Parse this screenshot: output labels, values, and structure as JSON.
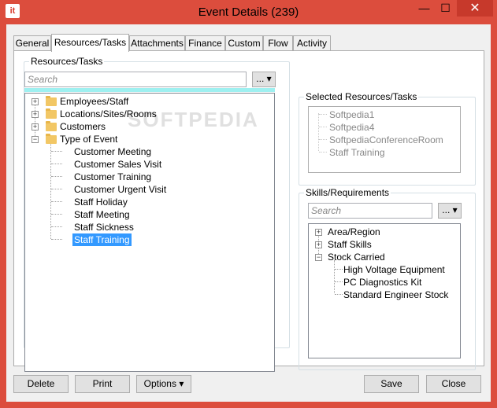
{
  "window": {
    "title": "Event Details (239)",
    "icon_text": "it",
    "controls": {
      "minimize": "—",
      "maximize": "☐",
      "close": "✕"
    }
  },
  "tabs": [
    {
      "label": "General"
    },
    {
      "label": "Resources/Tasks",
      "active": true
    },
    {
      "label": "Attachments"
    },
    {
      "label": "Finance"
    },
    {
      "label": "Custom"
    },
    {
      "label": "Flow"
    },
    {
      "label": "Activity"
    }
  ],
  "resources": {
    "group_label": "Resources/Tasks",
    "search_placeholder": "Search",
    "dropdown_label": "...",
    "watermark": "SOFTPEDIA",
    "tree": [
      {
        "label": "Employees/Staff"
      },
      {
        "label": "Locations/Sites/Rooms"
      },
      {
        "label": "Customers"
      },
      {
        "label": "Type of Event"
      },
      {
        "label": "Customer Meeting"
      },
      {
        "label": "Customer Sales Visit"
      },
      {
        "label": "Customer Training"
      },
      {
        "label": "Customer Urgent Visit"
      },
      {
        "label": "Staff Holiday"
      },
      {
        "label": "Staff Meeting"
      },
      {
        "label": "Staff Sickness"
      },
      {
        "label": "Staff Training"
      }
    ]
  },
  "selected": {
    "group_label": "Selected Resources/Tasks",
    "items": [
      {
        "label": "Softpedia1"
      },
      {
        "label": "Softpedia4"
      },
      {
        "label": "SoftpediaConferenceRoom"
      },
      {
        "label": "Staff Training"
      }
    ]
  },
  "skills": {
    "group_label": "Skills/Requirements",
    "search_placeholder": "Search",
    "dropdown_label": "...",
    "tree": [
      {
        "label": "Area/Region"
      },
      {
        "label": "Staff Skills"
      },
      {
        "label": "Stock Carried"
      },
      {
        "label": "High Voltage Equipment"
      },
      {
        "label": "PC Diagnostics Kit"
      },
      {
        "label": "Standard Engineer Stock"
      }
    ]
  },
  "buttons": {
    "delete": "Delete",
    "print": "Print",
    "options": "Options",
    "save": "Save",
    "close": "Close"
  }
}
